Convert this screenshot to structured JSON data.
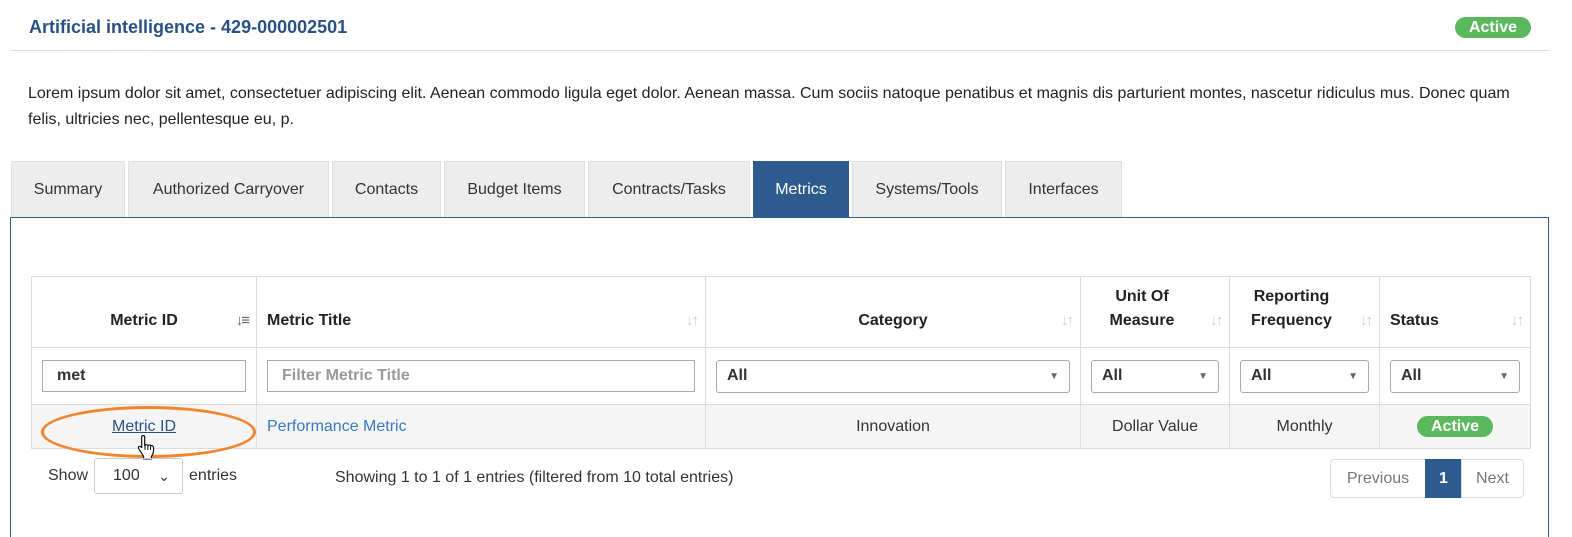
{
  "header": {
    "title": "Artificial intelligence - 429-000002501",
    "status": "Active"
  },
  "description": "Lorem ipsum dolor sit amet, consectetuer adipiscing elit. Aenean commodo ligula eget dolor. Aenean massa. Cum sociis natoque penatibus et magnis dis parturient montes, nascetur ridiculus mus. Donec quam felis, ultricies nec, pellentesque eu, p.",
  "tabs": [
    {
      "label": "Summary"
    },
    {
      "label": "Authorized Carryover"
    },
    {
      "label": "Contacts"
    },
    {
      "label": "Budget Items"
    },
    {
      "label": "Contracts/Tasks"
    },
    {
      "label": "Metrics",
      "active": true
    },
    {
      "label": "Systems/Tools"
    },
    {
      "label": "Interfaces"
    }
  ],
  "table": {
    "columns": [
      {
        "label": "Metric ID",
        "label2": ""
      },
      {
        "label": "Metric Title",
        "label2": ""
      },
      {
        "label": "Category",
        "label2": ""
      },
      {
        "label": "Unit Of",
        "label2": "Measure"
      },
      {
        "label": "Reporting",
        "label2": "Frequency"
      },
      {
        "label": "Status",
        "label2": ""
      }
    ],
    "filters": {
      "metric_id_value": "met",
      "metric_title_placeholder": "Filter Metric Title",
      "category": "All",
      "unit": "All",
      "frequency": "All",
      "status": "All"
    },
    "rows": [
      {
        "metric_id": "Metric ID",
        "metric_title": "Performance Metric",
        "category": "Innovation",
        "unit": "Dollar Value",
        "frequency": "Monthly",
        "status": "Active"
      }
    ]
  },
  "footer": {
    "show_label": "Show",
    "page_length": "100",
    "entries_label": "entries",
    "info": "Showing 1 to 1 of 1 entries (filtered from 10 total entries)",
    "previous": "Previous",
    "current_page": "1",
    "next": "Next"
  },
  "colors": {
    "accent": "#2d5b8e",
    "status_active": "#5cb85c",
    "highlight": "#f0852c"
  }
}
